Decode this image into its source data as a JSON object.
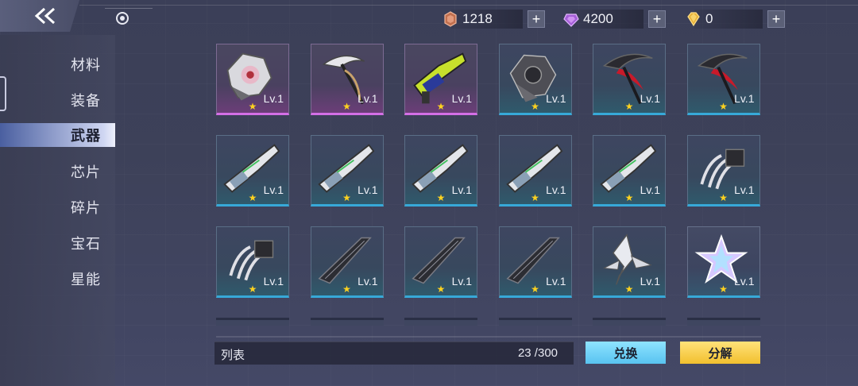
{
  "currencies": [
    {
      "icon": "red-crystal-icon",
      "value": "1218"
    },
    {
      "icon": "purple-gem-icon",
      "value": "4200"
    },
    {
      "icon": "gold-diamond-icon",
      "value": "0"
    }
  ],
  "plus_label": "+",
  "sidebar": {
    "items": [
      {
        "label": "材料"
      },
      {
        "label": "装备"
      },
      {
        "label": "武器",
        "active": true
      },
      {
        "label": "芯片"
      },
      {
        "label": "碎片"
      },
      {
        "label": "宝石"
      },
      {
        "label": "星能"
      }
    ]
  },
  "inventory": {
    "items": [
      {
        "name": "gauntlet-white-red",
        "rarity": "purple",
        "level": "Lv.1",
        "star": "★"
      },
      {
        "name": "scythe-white",
        "rarity": "purple",
        "level": "Lv.1",
        "star": "★"
      },
      {
        "name": "blaster-yellow-blue",
        "rarity": "purple",
        "level": "Lv.1",
        "star": "★"
      },
      {
        "name": "gauntlet-dark",
        "rarity": "blue",
        "level": "Lv.1",
        "star": "★"
      },
      {
        "name": "scythe-red",
        "rarity": "blue",
        "level": "Lv.1",
        "star": "★"
      },
      {
        "name": "scythe-red",
        "rarity": "blue",
        "level": "Lv.1",
        "star": "★"
      },
      {
        "name": "cannon-white",
        "rarity": "blue",
        "level": "Lv.1",
        "star": "★"
      },
      {
        "name": "cannon-white",
        "rarity": "blue",
        "level": "Lv.1",
        "star": "★"
      },
      {
        "name": "cannon-white",
        "rarity": "blue",
        "level": "Lv.1",
        "star": "★"
      },
      {
        "name": "cannon-white",
        "rarity": "blue",
        "level": "Lv.1",
        "star": "★"
      },
      {
        "name": "cannon-white",
        "rarity": "blue",
        "level": "Lv.1",
        "star": "★"
      },
      {
        "name": "claw-silver",
        "rarity": "blue",
        "level": "Lv.1",
        "star": "★"
      },
      {
        "name": "claw-silver",
        "rarity": "blue",
        "level": "Lv.1",
        "star": "★"
      },
      {
        "name": "blade-dark",
        "rarity": "blue",
        "level": "Lv.1",
        "star": "★"
      },
      {
        "name": "blade-dark",
        "rarity": "blue",
        "level": "Lv.1",
        "star": "★"
      },
      {
        "name": "blade-dark",
        "rarity": "blue",
        "level": "Lv.1",
        "star": "★"
      },
      {
        "name": "wing-blade-white",
        "rarity": "blue",
        "level": "Lv.1",
        "star": "★"
      },
      {
        "name": "star-crystal",
        "rarity": "white",
        "level": "Lv.1",
        "star": "★"
      }
    ]
  },
  "footer": {
    "list_label": "列表",
    "count": "23 /300",
    "exchange_label": "兑换",
    "decompose_label": "分解"
  },
  "colors": {
    "accent_purple": "#d46fe6",
    "accent_blue": "#37a9d8",
    "exchange_button": "#58c3f0",
    "decompose_button": "#f2c02e",
    "star": "#ffd21f"
  }
}
